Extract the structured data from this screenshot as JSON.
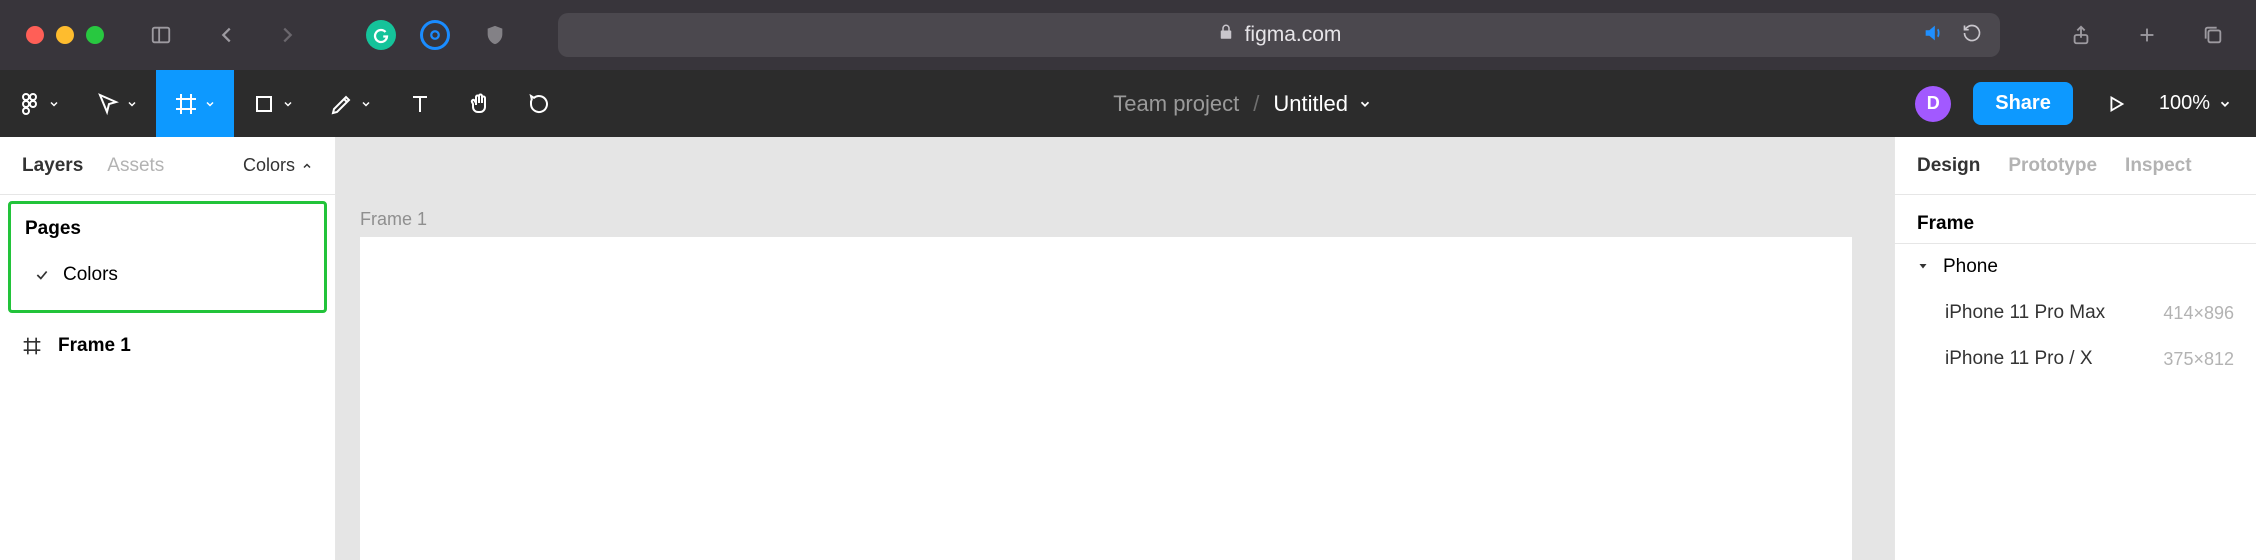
{
  "browser": {
    "domain": "figma.com"
  },
  "figma": {
    "breadcrumb": {
      "team": "Team project",
      "doc": "Untitled"
    },
    "avatar_initial": "D",
    "share_label": "Share",
    "zoom": "100%"
  },
  "left_panel": {
    "tabs": {
      "layers": "Layers",
      "assets": "Assets"
    },
    "page_picker": "Colors",
    "pages_header": "Pages",
    "pages": [
      {
        "name": "Colors",
        "selected": true
      }
    ],
    "layers": [
      {
        "name": "Frame 1"
      }
    ]
  },
  "canvas": {
    "frame_label": "Frame 1"
  },
  "right_panel": {
    "tabs": {
      "design": "Design",
      "prototype": "Prototype",
      "inspect": "Inspect"
    },
    "frame_section": "Frame",
    "category": "Phone",
    "presets": [
      {
        "name": "iPhone 11 Pro Max",
        "dims": "414×896"
      },
      {
        "name": "iPhone 11 Pro / X",
        "dims": "375×812"
      }
    ]
  },
  "chart_data": null
}
